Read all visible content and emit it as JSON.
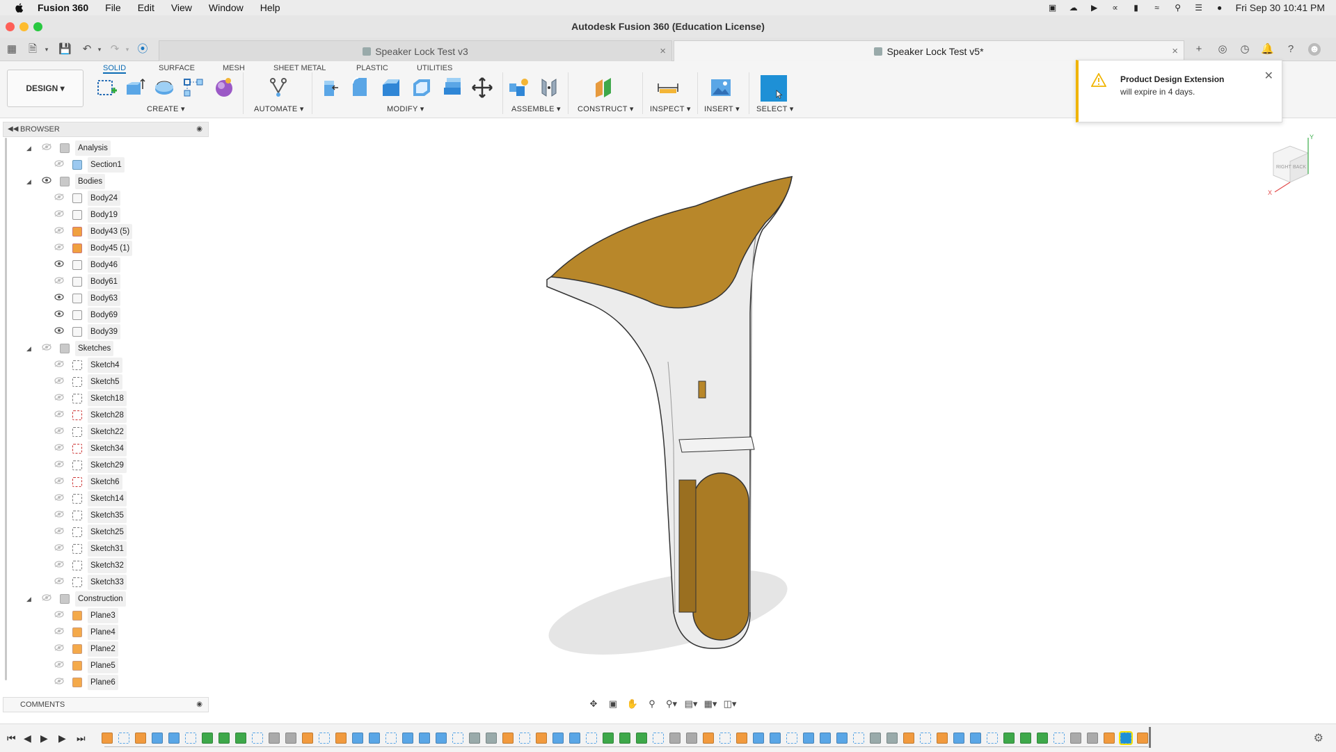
{
  "menubar": {
    "app_name": "Fusion 360",
    "menus": [
      "File",
      "Edit",
      "View",
      "Window",
      "Help"
    ],
    "clock": "Fri Sep 30  10:41 PM"
  },
  "window": {
    "title": "Autodesk Fusion 360 (Education License)"
  },
  "tabs": [
    {
      "label": "Speaker Lock Test v3",
      "active": false
    },
    {
      "label": "Speaker Lock Test v5*",
      "active": true
    }
  ],
  "toolbar": {
    "workspace": "DESIGN",
    "workspace_tabs": [
      "SOLID",
      "SURFACE",
      "MESH",
      "SHEET METAL",
      "PLASTIC",
      "UTILITIES"
    ],
    "active_tab": "SOLID",
    "groups": [
      "CREATE",
      "AUTOMATE",
      "MODIFY",
      "ASSEMBLE",
      "CONSTRUCT",
      "INSPECT",
      "INSERT",
      "SELECT"
    ]
  },
  "notification": {
    "title": "Product Design Extension",
    "message": "will expire in 4 days."
  },
  "browser": {
    "title": "BROWSER",
    "folders": {
      "analysis": {
        "label": "Analysis",
        "items": [
          {
            "label": "Section1",
            "icon": "section-icon"
          }
        ]
      },
      "bodies": {
        "label": "Bodies",
        "items": [
          {
            "label": "Body24",
            "icon": "body-icon"
          },
          {
            "label": "Body19",
            "icon": "body-icon"
          },
          {
            "label": "Body43 (5)",
            "icon": "component-body-icon"
          },
          {
            "label": "Body45 (1)",
            "icon": "component-body-icon"
          },
          {
            "label": "Body46",
            "icon": "body-icon"
          },
          {
            "label": "Body61",
            "icon": "body-icon"
          },
          {
            "label": "Body63",
            "icon": "body-icon"
          },
          {
            "label": "Body69",
            "icon": "body-icon"
          },
          {
            "label": "Body39",
            "icon": "body-icon"
          }
        ]
      },
      "sketches": {
        "label": "Sketches",
        "items": [
          {
            "label": "Sketch4"
          },
          {
            "label": "Sketch5"
          },
          {
            "label": "Sketch18"
          },
          {
            "label": "Sketch28"
          },
          {
            "label": "Sketch22"
          },
          {
            "label": "Sketch34"
          },
          {
            "label": "Sketch29"
          },
          {
            "label": "Sketch6"
          },
          {
            "label": "Sketch14"
          },
          {
            "label": "Sketch35"
          },
          {
            "label": "Sketch25"
          },
          {
            "label": "Sketch31"
          },
          {
            "label": "Sketch32"
          },
          {
            "label": "Sketch33"
          }
        ]
      },
      "construction": {
        "label": "Construction",
        "items": [
          {
            "label": "Plane3"
          },
          {
            "label": "Plane4"
          },
          {
            "label": "Plane2"
          },
          {
            "label": "Plane5"
          },
          {
            "label": "Plane6"
          }
        ]
      }
    }
  },
  "comments": {
    "title": "COMMENTS"
  },
  "viewcube": {
    "faces": [
      "RIGHT",
      "BACK"
    ],
    "axes": [
      "Y",
      "X"
    ]
  },
  "colors": {
    "accent": "#0a6bb4",
    "body_gold": "#b8872a",
    "body_grey": "#e8e8e8",
    "select_blue": "#1e90d6",
    "notif_warning": "#f0b400"
  }
}
